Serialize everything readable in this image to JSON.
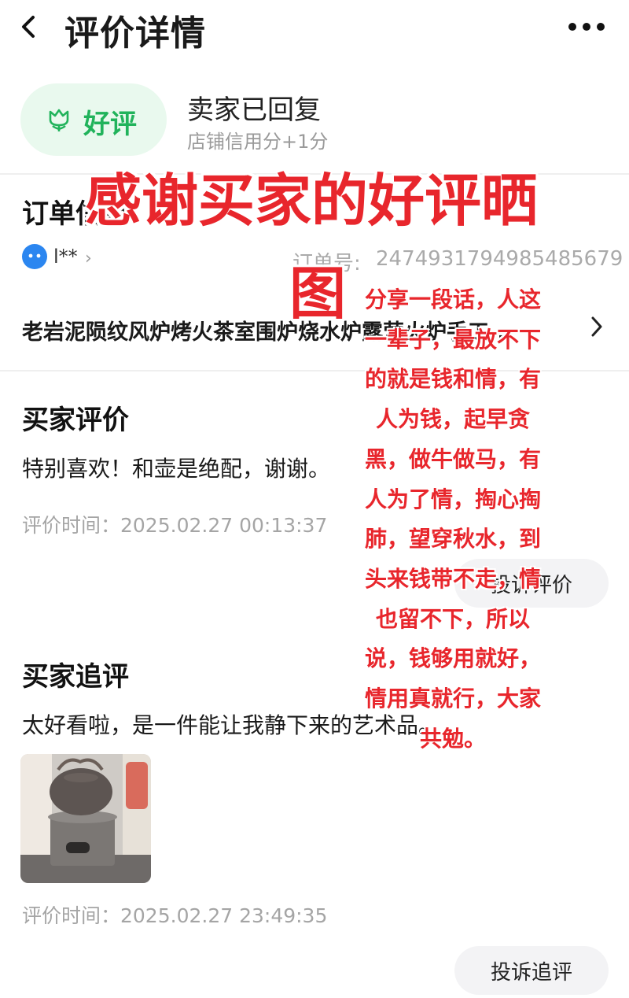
{
  "header": {
    "title": "评价详情",
    "back_icon": "chevron-left-icon",
    "more_icon": "more-horizontal-icon"
  },
  "rating": {
    "label": "好评",
    "icon": "tulip-icon",
    "reply_status": "卖家已回复",
    "credit_note": "店铺信用分+1分",
    "accent_color": "#21b35b"
  },
  "order_info": {
    "title": "订单信息",
    "buyer_name": "l**",
    "order_label": "订单号:",
    "order_number": "2474931794985485679",
    "product_title": "老岩泥陨纹风炉烤火茶室围炉烧水炉露营火炉手工..."
  },
  "buyer_review": {
    "title": "买家评价",
    "text": "特别喜欢！和壶是绝配，谢谢。",
    "time_label": "评价时间：2025.02.27 00:13:37",
    "complain_button": "投诉评价"
  },
  "follow_up": {
    "title": "买家追评",
    "text": "太好看啦，是一件能让我静下来的艺术品。",
    "time_label": "评价时间：2025.02.27 23:49:35",
    "complain_button": "投诉追评"
  },
  "overlay": {
    "headline_1": "感谢买家的好评晒",
    "headline_2": "图",
    "body": "分享一段话，人这\n一辈子，最放不下\n的就是钱和情，有\n人为钱，起早贪\n黑，做牛做马，有\n人为了情，掏心掏\n肺，望穿秋水，到\n头来钱带不走，情\n也留不下，所以\n说，钱够用就好，\n情用真就行，大家\n共勉。",
    "color": "#e8262c"
  }
}
